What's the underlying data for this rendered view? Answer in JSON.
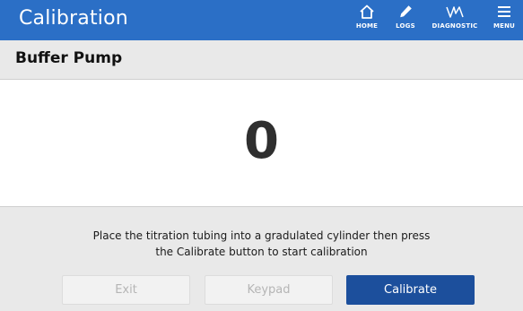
{
  "header": {
    "title": "Calibration",
    "nav": [
      {
        "label": "HOME",
        "icon": "home-icon"
      },
      {
        "label": "LOGS",
        "icon": "pencil-icon"
      },
      {
        "label": "DIAGNOSTIC",
        "icon": "waveform-icon"
      },
      {
        "label": "MENU",
        "icon": "menu-icon"
      }
    ]
  },
  "section": {
    "title": "Buffer Pump"
  },
  "display": {
    "value": "0"
  },
  "instruction": {
    "line1": "Place the titration tubing into a gradulated cylinder then press",
    "line2": "the Calibrate button to start calibration"
  },
  "buttons": {
    "exit": "Exit",
    "keypad": "Keypad",
    "calibrate": "Calibrate"
  },
  "colors": {
    "header_bg": "#2b6fc6",
    "primary_button": "#1c4f9c",
    "page_bg": "#e9e9e9"
  }
}
